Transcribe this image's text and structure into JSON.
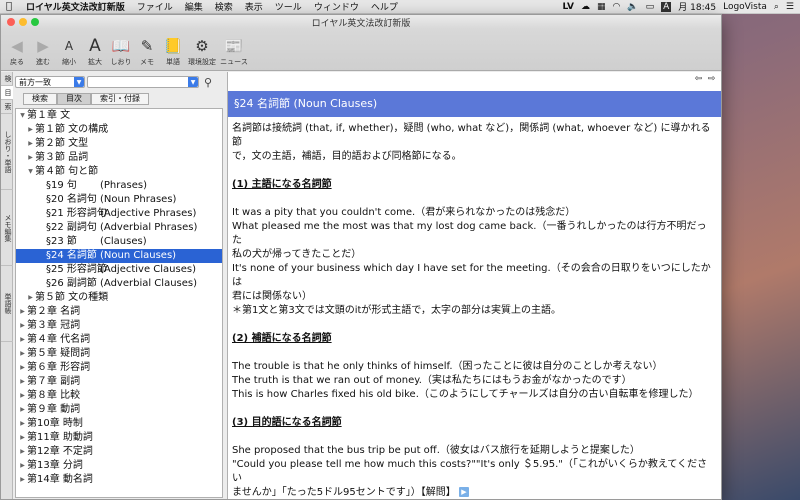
{
  "menubar": {
    "app": "ロイヤル英文法改訂新版",
    "items": [
      "ファイル",
      "編集",
      "検索",
      "表示",
      "ツール",
      "ウィンドウ",
      "ヘルプ"
    ],
    "right": {
      "lv": "LV",
      "clock": "月 18:45",
      "brand": "LogoVista"
    }
  },
  "window": {
    "title": "ロイヤル英文法改訂新版"
  },
  "toolbar": {
    "back": "戻る",
    "forward": "進む",
    "shrink": "縮小",
    "enlarge": "拡大",
    "bookmark": "しおり",
    "memo": "メモ",
    "words": "単語",
    "settings": "環境設定",
    "news": "ニュース"
  },
  "vtabs": [
    "検",
    "目",
    "索",
    "しおり・単語",
    "メモ編集",
    "単語帳"
  ],
  "search": {
    "mode": "前方一致",
    "query": ""
  },
  "tabs": [
    "検索",
    "目次",
    "索引・付録"
  ],
  "tree": {
    "ch1": "第１章  文",
    "s1": "第１節  文の構成",
    "s2": "第２節  文型",
    "s3": "第３節  品詞",
    "s4": "第４節  句と節",
    "items": [
      {
        "sec": "§19  句",
        "en": "(Phrases)"
      },
      {
        "sec": "§20  名詞句",
        "en": "(Noun Phrases)"
      },
      {
        "sec": "§21  形容詞句",
        "en": "(Adjective Phrases)"
      },
      {
        "sec": "§22  副詞句",
        "en": "(Adverbial Phrases)"
      },
      {
        "sec": "§23  節",
        "en": "(Clauses)"
      },
      {
        "sec": "§24  名詞節",
        "en": "(Noun Clauses)"
      },
      {
        "sec": "§25  形容詞節",
        "en": "(Adjective Clauses)"
      },
      {
        "sec": "§26  副詞節",
        "en": "(Adverbial Clauses)"
      }
    ],
    "s5": "第５節  文の種類",
    "chapters": [
      "第２章  名詞",
      "第３章  冠詞",
      "第４章  代名詞",
      "第５章  疑問詞",
      "第６章  形容詞",
      "第７章  副詞",
      "第８章  比較",
      "第９章  動詞",
      "第10章  時制",
      "第11章  助動詞",
      "第12章  不定詞",
      "第13章  分詞",
      "第14章  動名詞"
    ]
  },
  "content": {
    "banner": "§24 名詞節 (Noun Clauses)",
    "intro1": "名詞節は接続詞 (that, if, whether)，疑問 (who, what など)，関係詞 (what, whoever など) に導かれる節",
    "intro2": "で，文の主語，補語，目的語および同格節になる。",
    "h1": "(1) 主語になる名詞節",
    "ex1": [
      "It was a pity that you couldn't come.（君が来られなかったのは残念だ）",
      "What pleased me the most was that my lost dog came back.（一番うれしかったのは行方不明だった",
      "私の犬が帰ってきたことだ）",
      "It's none of your business which day I have set for the meeting.（その会合の日取りをいつにしたかは",
      "君には関係ない）",
      "＊第1文と第3文では文頭のitが形式主語で，太字の部分は実質上の主語。"
    ],
    "h2": "(2) 補語になる名詞節",
    "ex2": [
      "The trouble is that he only thinks of himself.（困ったことに彼は自分のことしか考えない）",
      "The truth is that we ran out of money.（実は私たちにはもうお金がなかったのです）",
      "This is how Charles fixed his old bike.（このようにしてチャールズは自分の古い自転車を修理した）"
    ],
    "h3": "(3) 目的語になる名詞節",
    "ex3": [
      "She proposed that the bus trip be put off.（彼女はバス旅行を延期しようと提案した）",
      "\"Could you please tell me how much this costs?\"\"It's only ＄5.95.\"（「これがいくらか教えてください",
      "ませんか」「たった5ドル95セントです」）【解問】"
    ]
  }
}
